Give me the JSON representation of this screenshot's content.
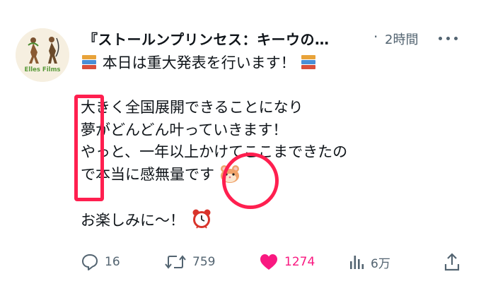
{
  "author": {
    "name": "『ストールンプリンセス：キーウの…",
    "separator": "·",
    "time": "2時間"
  },
  "avatar": {
    "logo_text": "Elles Films"
  },
  "post": {
    "lines": [
      "本日は重大発表を行います！",
      "大きく全国展開できることになり",
      "夢がどんどん叶っていきます！",
      "やっと、一年以上かけてここまできたの",
      "で本当に感無量です",
      "お楽しみに〜！"
    ],
    "emojis": [
      "books-emoji",
      "hamster-emoji",
      "alarm-clock-emoji"
    ]
  },
  "actions": {
    "replies": "16",
    "reposts": "759",
    "likes": "1274",
    "views": "6万"
  },
  "colors": {
    "accent_like": "#f91880",
    "secondary_text": "#536471",
    "annotation": "#ff1f4f"
  },
  "icons": [
    "more-icon",
    "reply-icon",
    "repost-icon",
    "like-icon",
    "views-icon",
    "share-icon"
  ]
}
